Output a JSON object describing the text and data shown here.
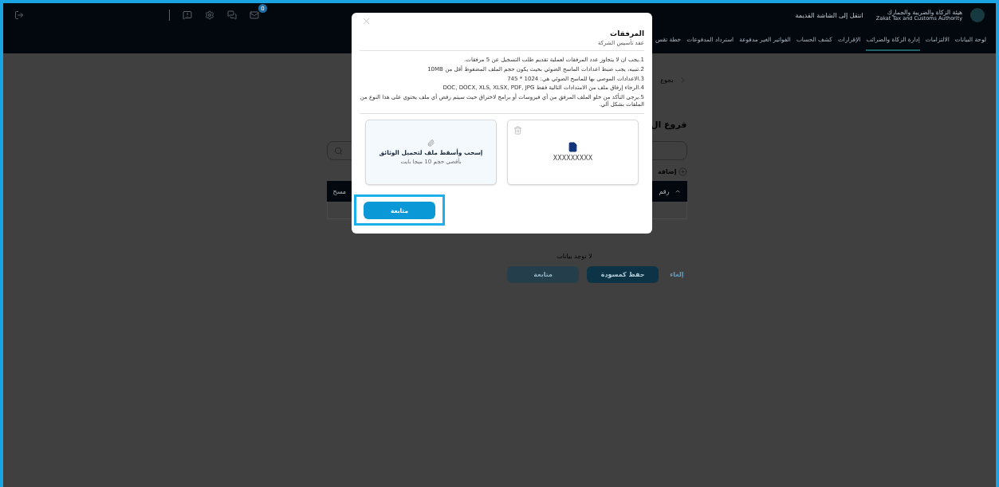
{
  "header": {
    "org_name_ar": "هيئة الزكاة والضريبة والجمارك",
    "org_name_en": "Zakat Tax and Customs Authority",
    "old_screen_link": "انتقل إلى الشاشة القديمة",
    "mail_badge": "0"
  },
  "nav": [
    {
      "label": "لوحة البيانات",
      "selected": false
    },
    {
      "label": "الالتزامات",
      "selected": false
    },
    {
      "label": "إدارة الزكاة والضرائب",
      "selected": true
    },
    {
      "label": "الإقرارات",
      "selected": false
    },
    {
      "label": "كشف الحساب",
      "selected": false
    },
    {
      "label": "الفواتير الغير مدفوعة",
      "selected": false
    },
    {
      "label": "استرداد المدفوعات",
      "selected": false
    },
    {
      "label": "خطة تقس",
      "selected": false
    }
  ],
  "page": {
    "back": "بجوع",
    "heading": "فروع ال",
    "add": "إضافة",
    "table_columns": [
      "رقم",
      "مسح"
    ],
    "empty": "لا توجد بيانات",
    "buttons": [
      {
        "label": "إلغاء",
        "kind": "link",
        "disabled": false
      },
      {
        "label": "حفظ كمسودة",
        "kind": "primary",
        "disabled": false
      },
      {
        "label": "متابعة",
        "kind": "primary",
        "disabled": true
      }
    ]
  },
  "modal": {
    "title": "المرفقات",
    "subtitle": "عقد تأسيس الشركة",
    "rules": [
      "1.يجب ان لا يتجاوز عدد المرفقات لعملية تقديم طلب التسجيل عن 5 مرفقات.",
      "2.تنبيه، يجب ضبط اعدادات الماسح الضوئي بحيث يكون حجم الملف المضغوط أقل من 10MB",
      "3.الاعدادات الموصى بها للماسح الضوئي هي: 1024 * 745",
      "4.الرجاء إرفاق ملف من الامتدادات التالية فقط DOC, DOCX, XLS, XLSX, PDF, JPG",
      "5.يرجى التأكد من خلو الملف المرفق من أي فيروسات أو برامج لاختراق حيث سيتم رفض أي ملف يحتوي على هذا النوع من الملفات بشكل آلي."
    ],
    "cards": [
      {
        "kind": "file",
        "name": "XXXXXXXXX"
      },
      {
        "kind": "dropzone",
        "title": "إسحب وأسقط ملف لتحميل الوثائق",
        "hint": "بأقصى حجم 10 ميجا بايت"
      }
    ],
    "continue": "متابعة",
    "highlighted": true
  }
}
